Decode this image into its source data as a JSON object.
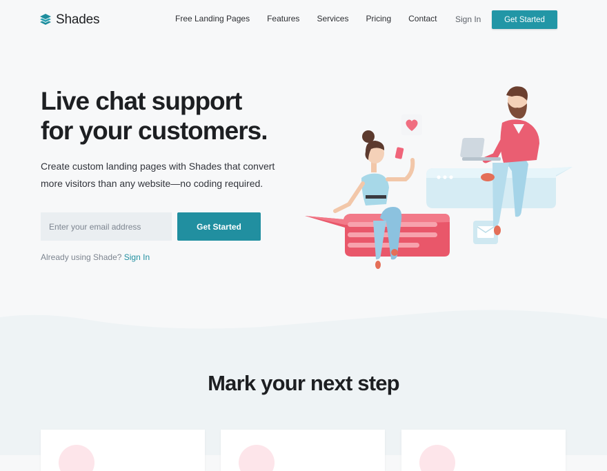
{
  "brand": {
    "name": "Shades",
    "accent": "#2296a6",
    "logo_icon": "stacked-layers-icon"
  },
  "nav": {
    "items": [
      {
        "label": "Free Landing Pages"
      },
      {
        "label": "Features"
      },
      {
        "label": "Services"
      },
      {
        "label": "Pricing"
      },
      {
        "label": "Contact"
      }
    ],
    "signin_label": "Sign In",
    "cta_label": "Get Started"
  },
  "hero": {
    "title_line1": "Live chat support",
    "title_line2": "for your customers.",
    "subtitle": "Create custom landing pages with Shades that convert more visitors than any website—no coding required.",
    "email_placeholder": "Enter your email address",
    "cta_label": "Get Started",
    "already_text": "Already using Shade?",
    "signin_link": "Sign In",
    "illustration": "people-chatting-on-speech-bubbles-illustration"
  },
  "section": {
    "title": "Mark your next step",
    "cards": [
      {
        "icon": "feature-circle-icon"
      },
      {
        "icon": "feature-circle-icon"
      },
      {
        "icon": "feature-circle-icon"
      }
    ]
  },
  "colors": {
    "background": "#f7f8f9",
    "section_background": "#eef3f5",
    "button": "#218fa0",
    "bubble_pink": "#ef5f71",
    "bubble_blue": "#d8eef6",
    "heart": "#f06e80"
  }
}
